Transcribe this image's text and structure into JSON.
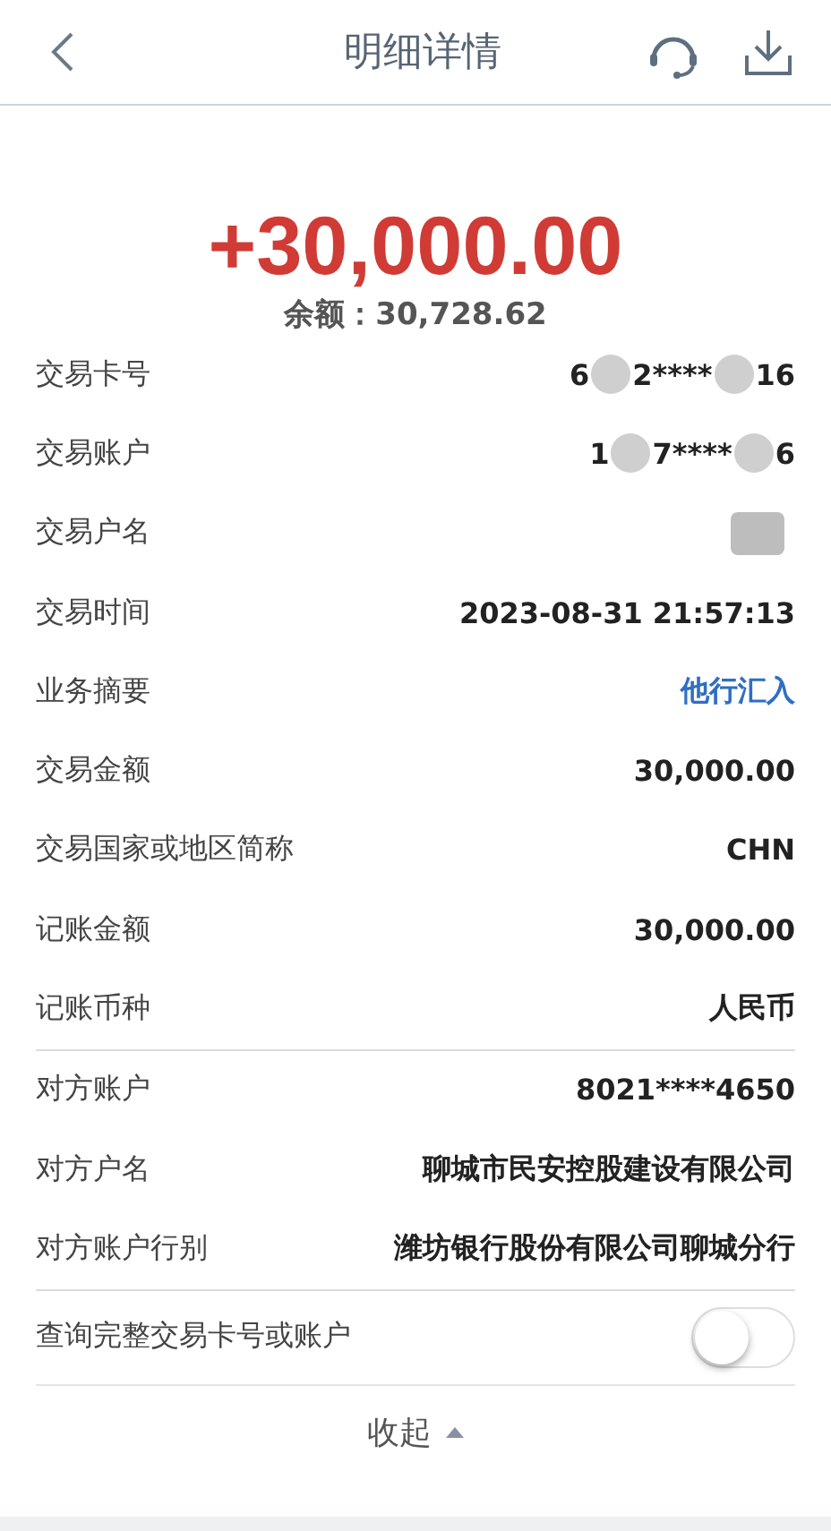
{
  "header": {
    "title": "明细详情"
  },
  "amount": "+30,000.00",
  "balance": {
    "label": "余额：",
    "value": "30,728.62"
  },
  "sections": [
    [
      {
        "label": "交易卡号",
        "kind": "masked",
        "value_parts": [
          "6",
          "2****",
          "16"
        ]
      },
      {
        "label": "交易账户",
        "kind": "masked",
        "value_parts": [
          "1",
          "7****",
          "6"
        ]
      },
      {
        "label": "交易户名",
        "kind": "redacted"
      },
      {
        "label": "交易时间",
        "kind": "text",
        "value": "2023-08-31 21:57:13"
      },
      {
        "label": "业务摘要",
        "kind": "link",
        "value": "他行汇入"
      },
      {
        "label": "交易金额",
        "kind": "text",
        "value": "30,000.00"
      },
      {
        "label": "交易国家或地区简称",
        "kind": "text",
        "value": "CHN"
      },
      {
        "label": "记账金额",
        "kind": "text",
        "value": "30,000.00"
      },
      {
        "label": "记账币种",
        "kind": "text",
        "value": "人民币"
      }
    ],
    [
      {
        "label": "对方账户",
        "kind": "text",
        "value": "8021****4650"
      },
      {
        "label": "对方户名",
        "kind": "text",
        "value": "聊城市民安控股建设有限公司"
      },
      {
        "label": "对方账户行别",
        "kind": "text",
        "value": "潍坊银行股份有限公司聊城分行"
      }
    ]
  ],
  "toggle": {
    "label": "查询完整交易卡号或账户",
    "on": false
  },
  "collapse": {
    "label": "收起"
  }
}
